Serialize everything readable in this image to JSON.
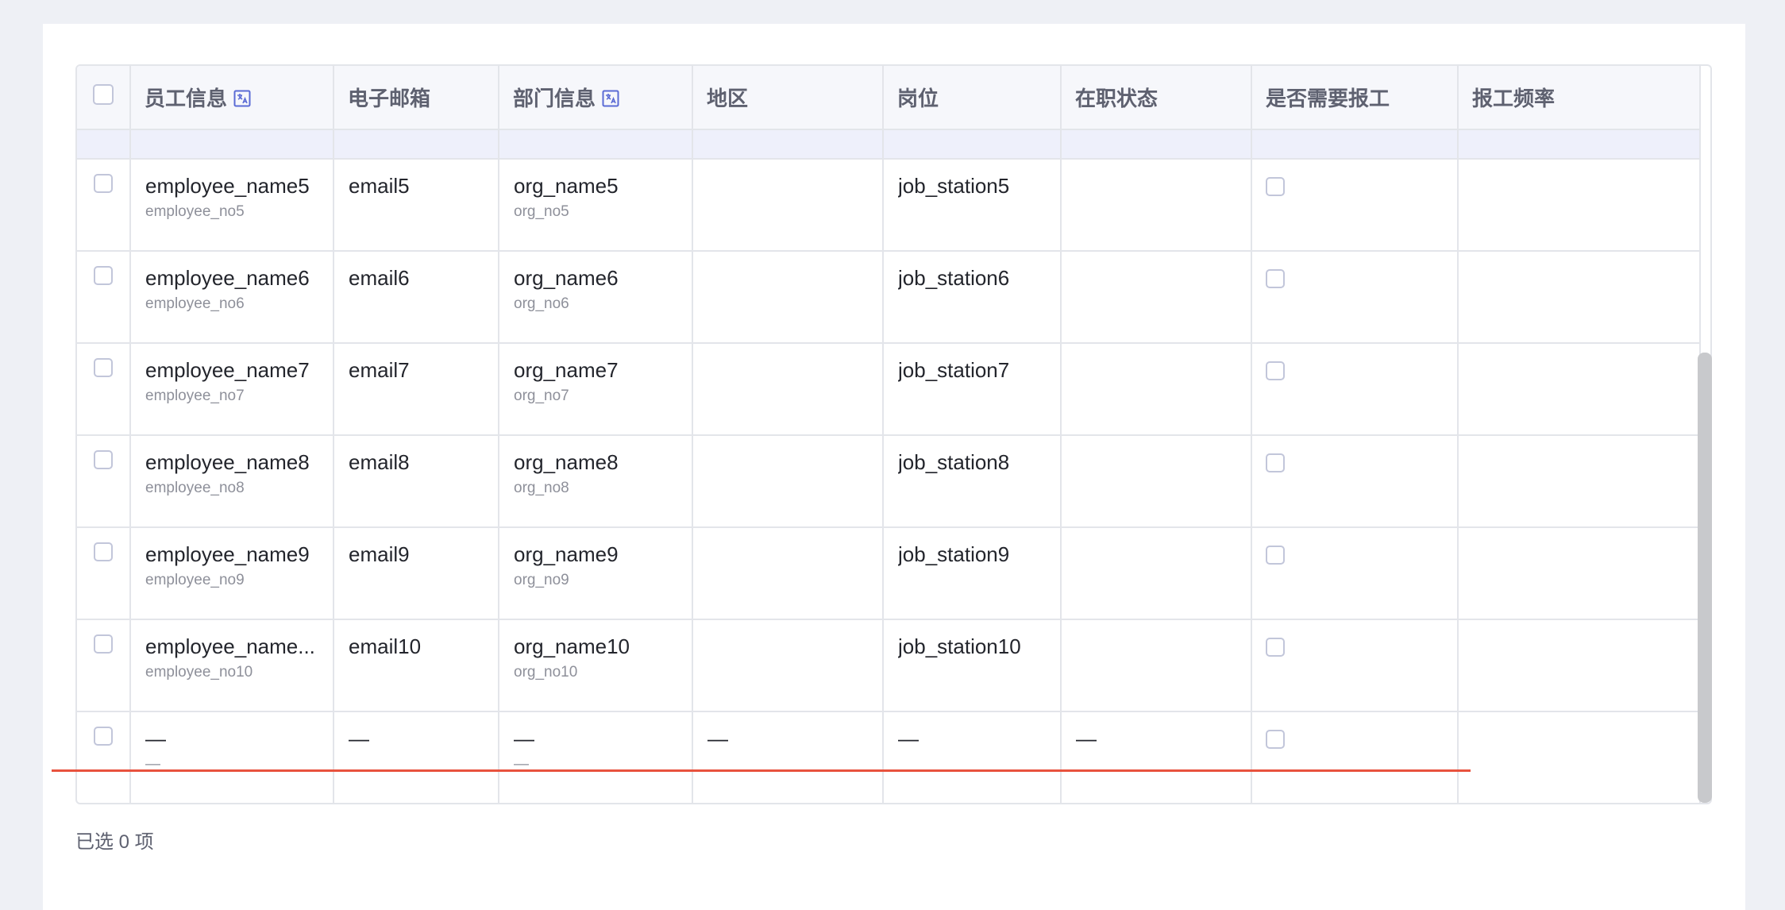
{
  "table": {
    "columns": [
      {
        "label": "员工信息",
        "icon": "translate-icon"
      },
      {
        "label": "电子邮箱"
      },
      {
        "label": "部门信息",
        "icon": "translate-icon"
      },
      {
        "label": "地区"
      },
      {
        "label": "岗位"
      },
      {
        "label": "在职状态"
      },
      {
        "label": "是否需要报工"
      },
      {
        "label": "报工频率"
      }
    ],
    "rows": [
      {
        "employee_name": "employee_name5",
        "employee_no": "employee_no5",
        "email": "email5",
        "org_name": "org_name5",
        "org_no": "org_no5",
        "region": "",
        "job_station": "job_station5",
        "status": "",
        "frequency": ""
      },
      {
        "employee_name": "employee_name6",
        "employee_no": "employee_no6",
        "email": "email6",
        "org_name": "org_name6",
        "org_no": "org_no6",
        "region": "",
        "job_station": "job_station6",
        "status": "",
        "frequency": ""
      },
      {
        "employee_name": "employee_name7",
        "employee_no": "employee_no7",
        "email": "email7",
        "org_name": "org_name7",
        "org_no": "org_no7",
        "region": "",
        "job_station": "job_station7",
        "status": "",
        "frequency": ""
      },
      {
        "employee_name": "employee_name8",
        "employee_no": "employee_no8",
        "email": "email8",
        "org_name": "org_name8",
        "org_no": "org_no8",
        "region": "",
        "job_station": "job_station8",
        "status": "",
        "frequency": ""
      },
      {
        "employee_name": "employee_name9",
        "employee_no": "employee_no9",
        "email": "email9",
        "org_name": "org_name9",
        "org_no": "org_no9",
        "region": "",
        "job_station": "job_station9",
        "status": "",
        "frequency": ""
      },
      {
        "employee_name": "employee_name...",
        "employee_no": "employee_no10",
        "email": "email10",
        "org_name": "org_name10",
        "org_no": "org_no10",
        "region": "",
        "job_station": "job_station10",
        "status": "",
        "frequency": ""
      },
      {
        "employee_name": "—",
        "employee_no": "—",
        "email": "—",
        "org_name": "—",
        "org_no": "—",
        "region": "—",
        "job_station": "—",
        "status": "—",
        "frequency": ""
      }
    ]
  },
  "footer": {
    "selection_text": "已选 0 项"
  },
  "colors": {
    "accent": "#5b6bd5",
    "header_bg": "#f6f7fb",
    "subheader_bg": "#eef0fb",
    "marker_line": "#e8523e"
  }
}
